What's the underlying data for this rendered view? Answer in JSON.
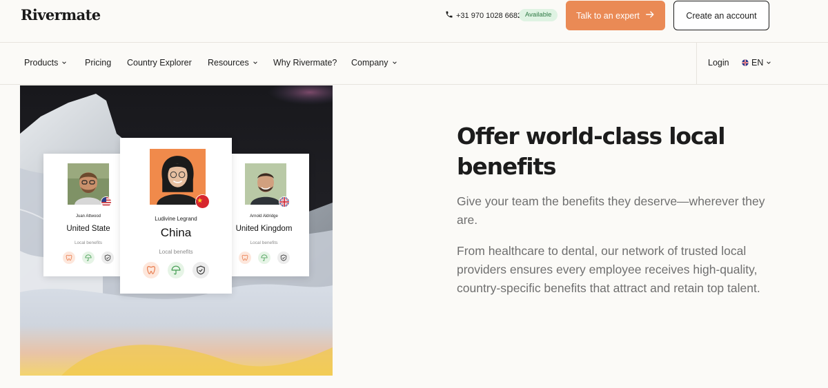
{
  "header": {
    "logo": "Rivermate",
    "phone": "+31 970 1028 6682",
    "availability": "Available",
    "cta_expert": "Talk to an expert",
    "cta_account": "Create an account"
  },
  "nav": {
    "items": [
      {
        "label": "Products",
        "dropdown": true
      },
      {
        "label": "Pricing",
        "dropdown": false
      },
      {
        "label": "Country Explorer",
        "dropdown": false
      },
      {
        "label": "Resources",
        "dropdown": true
      },
      {
        "label": "Why Rivermate?",
        "dropdown": false
      },
      {
        "label": "Company",
        "dropdown": true
      }
    ],
    "login": "Login",
    "language": "EN"
  },
  "hero_cards": [
    {
      "person": "Juan Attwood",
      "country": "United State",
      "benefits_label": "Local benefits",
      "flag": "us-flag-icon"
    },
    {
      "person": "Ludivine Legrand",
      "country": "China",
      "benefits_label": "Local benefits",
      "flag": "china-flag-icon"
    },
    {
      "person": "Arnold Aldridge",
      "country": "United Kingdom",
      "benefits_label": "Local benefits",
      "flag": "uk-flag-icon"
    }
  ],
  "benefit_icons": [
    "tooth-icon",
    "umbrella-icon",
    "shield-check-icon"
  ],
  "content": {
    "headline": "Offer world-class local benefits",
    "lead": "Give your team the benefits they deserve—wherever they are.",
    "body": "From healthcare to dental, our network of trusted local providers ensures every employee receives high-quality, country-specific benefits that attract and retain top talent."
  },
  "colors": {
    "accent": "#ea8a55",
    "available_bg": "#dff3e3",
    "available_text": "#2f7a45",
    "background": "#fbfaf7",
    "heading": "#1c1c1c",
    "body_text": "#6f6f6f"
  }
}
